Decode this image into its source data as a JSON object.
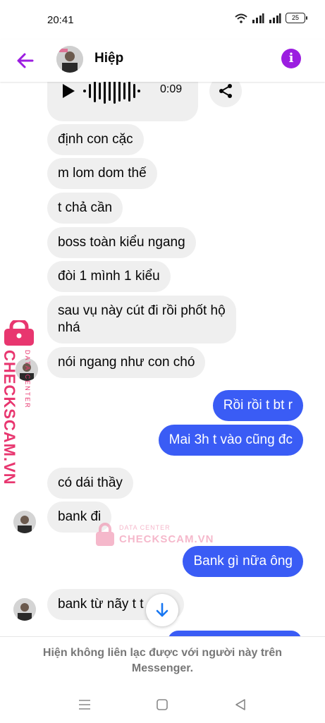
{
  "status_bar": {
    "time": "20:41",
    "battery": "25"
  },
  "header": {
    "contact_name": "Hiệp"
  },
  "audio_message": {
    "duration": "0:09"
  },
  "messages": [
    {
      "text": "định con cặc"
    },
    {
      "text": "m lom dom thế"
    },
    {
      "text": "t chả cần"
    },
    {
      "text": "boss toàn kiểu ngang"
    },
    {
      "text": "đòi 1 mình 1 kiểu"
    },
    {
      "text_line1": "sau vụ này cút đi rồi phốt hộ",
      "text_line2": "nhá"
    },
    {
      "text": "nói ngang như con chó"
    },
    {
      "text": "Rồi rồi t bt r"
    },
    {
      "text": "Mai 3h t vào cũng đc"
    },
    {
      "text": "có dái thầy"
    },
    {
      "text": "bank đi"
    },
    {
      "text": "Bank gì nữa ông"
    },
    {
      "text": "bank từ nãy t t    ến"
    }
  ],
  "footer": {
    "notice": "Hiện không liên lạc được với người này trên Messenger."
  },
  "watermark": {
    "brand": "CHECKSCAM.VN",
    "sub": "DATA CENTER",
    "brand_center": "CHECKSCAM.VN"
  },
  "colors": {
    "accent": "#9b1de0",
    "outgoing": "#3a5cf5",
    "incoming": "#efefef",
    "watermark": "#e8366f"
  },
  "icons": [
    "back-arrow-icon",
    "info-icon",
    "play-icon",
    "waveform-icon",
    "share-icon",
    "arrow-down-icon",
    "lock-icon",
    "recents-nav-icon",
    "home-nav-icon",
    "back-nav-icon"
  ]
}
